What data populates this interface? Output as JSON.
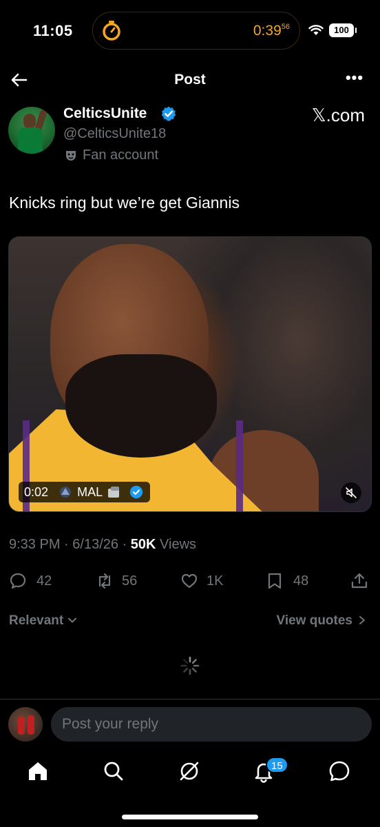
{
  "status_bar": {
    "time": "11:05",
    "timer": {
      "main": "0:39",
      "sub": "56",
      "color": "#f5a623"
    },
    "battery": "100"
  },
  "header": {
    "title": "Post",
    "back_icon": "arrow-left-icon",
    "more_icon": "more-horizontal-icon",
    "more_label": "•••"
  },
  "author": {
    "display_name": "CelticsUnite",
    "handle": "@CelticsUnite18",
    "label": "Fan account",
    "verified": true,
    "source_badge": "𝕏.com"
  },
  "post": {
    "text": "Knicks ring but we’re get Giannis",
    "media": {
      "duration": "0:02",
      "source_name": "MAL",
      "verified": true,
      "muted": true
    },
    "time": "9:33 PM",
    "date": "6/13/26",
    "views_count": "50K",
    "views_label": "Views",
    "meta_sep": " · "
  },
  "actions": {
    "replies": "42",
    "reposts": "56",
    "likes": "1K",
    "bookmarks": "48"
  },
  "filters": {
    "sort_label": "Relevant",
    "quotes_label": "View quotes"
  },
  "reply": {
    "placeholder": "Post your reply"
  },
  "nav": {
    "notifications_badge": "15"
  },
  "colors": {
    "accent": "#1d9bf0",
    "background": "#000000",
    "muted_text": "#71767b",
    "timer": "#f5a623"
  }
}
